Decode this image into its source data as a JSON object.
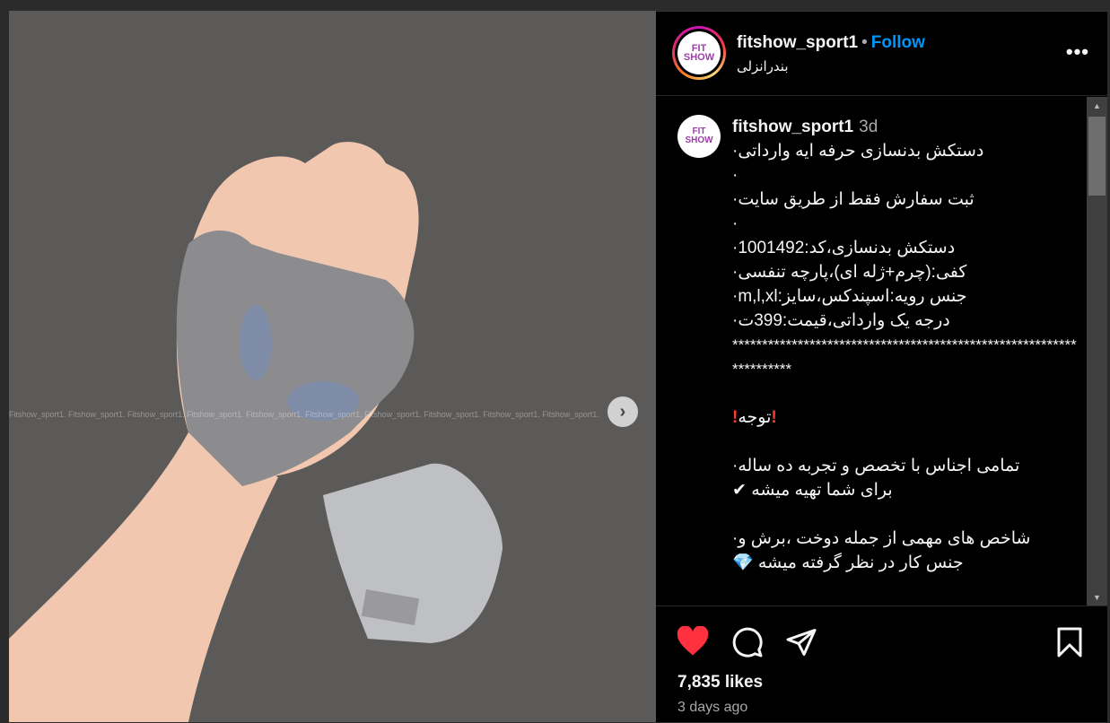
{
  "post": {
    "username": "fitshow_sport1",
    "follow_label": "Follow",
    "location": "بندرانزلی",
    "avatar_text": "FIT SHOW",
    "watermark": "Fitshow_sport1.  Fitshow_sport1.  Fitshow_sport1.  Fitshow_sport1.  Fitshow_sport1.  Fitshow_sport1.  Fitshow_sport1.  Fitshow_sport1.  Fitshow_sport1.  Fitshow_sport1.",
    "next_icon": "chevron-right-icon",
    "likes": "7,835 likes",
    "time_ago": "3 days ago"
  },
  "caption": {
    "username": "fitshow_sport1",
    "time": "3d",
    "lines": [
      "دستکش بدنسازی حرفه ایه وارداتی·",
      "·",
      "ثبت سفارش فقط از طریق سایت·",
      "·",
      "دستکش بدنسازی،کد:1001492·",
      "کفی:(چرم+ژله ای)،پارچه تنفسی·",
      "جنس رویه:اسپندکس،سایز:m,l,xl·",
      "درجه یک وارداتی،قیمت:399ت·"
    ],
    "stars": "********************************************************************",
    "warning": "توجه",
    "para1_line1": "تمامی اجناس با تخصص و تجربه ده ساله·",
    "para1_line2": "برای شما تهیه میشه ✔",
    "para2_line1": "شاخص های مهمی از جمله دوخت ،برش و·",
    "para2_line2": "جنس کار در نظر گرفته میشه 💎"
  },
  "colors": {
    "follow": "#0095f6",
    "like": "#ff3040",
    "check": "#18b418"
  }
}
